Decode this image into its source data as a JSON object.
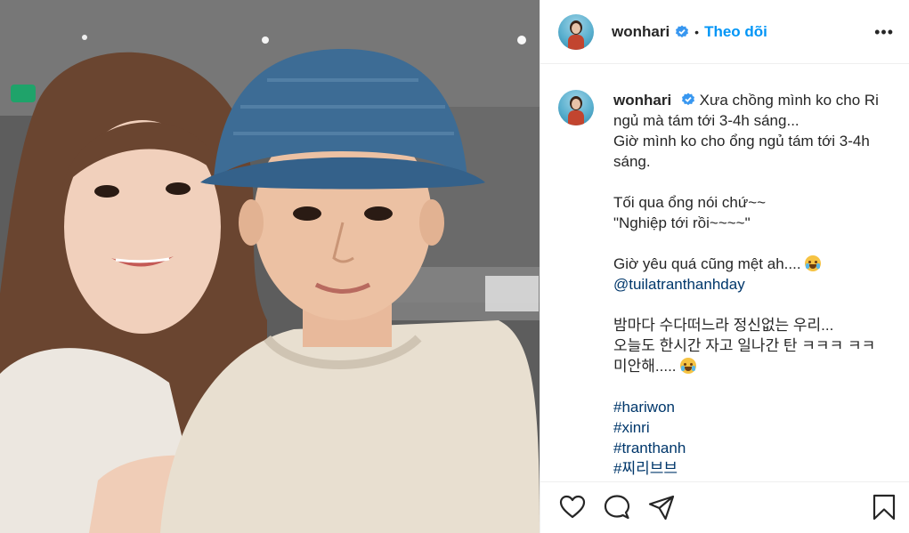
{
  "post": {
    "username": "wonhari",
    "separator": "•",
    "follow_label": "Theo dõi",
    "more_label": "•••"
  },
  "caption": {
    "username": "wonhari",
    "line1": "Xưa chồng mình ko cho Ri ngủ mà tám tới 3-4h sáng...",
    "line2": "Giờ mình ko cho ổng ngủ tám tới 3-4h sáng.",
    "line3": "Tối qua ổng nói chứ~~",
    "line4": "\"Nghiệp tới rồi~~~~\"",
    "line5": "Giờ yêu quá cũng mệt ah....",
    "mention": "@tuilatranthanhday",
    "korean1": "밤마다 수다떠느라 정신없는 우리...",
    "korean2": "오늘도 한시간 자고 일나간 탄 ㅋㅋㅋ ㅋㅋ",
    "korean3": "미안해.....",
    "hashtags": [
      "#hariwon",
      "#xinri",
      "#tranthanh",
      "#찌리브브"
    ]
  },
  "icons": {
    "verified": "verified-badge-icon",
    "like": "heart-icon",
    "comment": "comment-bubble-icon",
    "share": "paper-plane-icon",
    "save": "bookmark-icon",
    "emoji_cry": "loudly-crying-face-emoji",
    "emoji_laugh": "tears-of-joy-emoji"
  },
  "colors": {
    "accent": "#0095f6",
    "link": "#00376b",
    "text": "#262626",
    "divider": "#efefef"
  }
}
